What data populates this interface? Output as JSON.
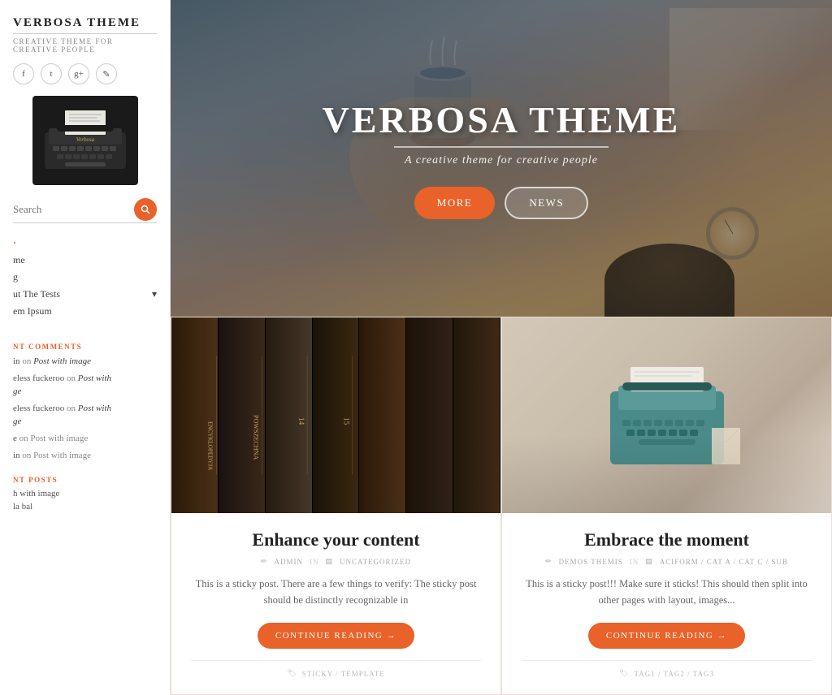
{
  "sidebar": {
    "brand_title": "VERBOSA THEME",
    "brand_subtitle": "CREATIVE THEME FOR CREATIVE PEOPLE",
    "social_icons": [
      "f",
      "t",
      "g+",
      "✎"
    ],
    "search_placeholder": "Search",
    "nav_items": [
      {
        "label": "·",
        "active": true
      },
      {
        "label": "me"
      },
      {
        "label": "g"
      },
      {
        "label": "ut The Tests",
        "has_arrow": true
      },
      {
        "label": "em Ipsum"
      }
    ],
    "recent_comments_title": "NT COMMENTS",
    "comments": [
      {
        "author": "in",
        "on_text": "on",
        "post": "Post with image"
      },
      {
        "author": "eless fuckeroo",
        "on_text": "on Post with",
        "post": "ge"
      },
      {
        "author": "eless fuckeroo",
        "on_text": "on Post with",
        "post": "ge"
      },
      {
        "author": "e",
        "on_text": "on Post with image"
      },
      {
        "author": "in",
        "on_text": "on Post with image"
      }
    ],
    "recent_posts_title": "NT POSTS",
    "recent_posts": [
      {
        "label": "h with image"
      },
      {
        "label": "la bal"
      }
    ]
  },
  "hero": {
    "title": "VERBOSA THEME",
    "subtitle": "A creative theme for creative people",
    "btn_more": "MORE",
    "btn_news": "NEWS"
  },
  "posts": [
    {
      "id": "post1",
      "title": "Enhance your content",
      "author": "ADMIN",
      "category": "UNCATEGORIZED",
      "excerpt": "This is a sticky post. There are a few things to verify: The sticky post should be distinctly recognizable in",
      "continue_label": "CONTINUE READING →",
      "footer_tags": "STICKY / TEMPLATE",
      "thumb_type": "books"
    },
    {
      "id": "post2",
      "title": "Embrace the moment",
      "author": "DEMOS THEMIS",
      "category": "ACIFORM / CAT A / CAT C / SUB",
      "excerpt": "This is a sticky post!!! Make sure it sticks! This should then split into other pages with layout, images...",
      "continue_label": "CONTINUE READING →",
      "footer_tags": "TAG1 / TAG2 / TAG3",
      "thumb_type": "typewriter"
    }
  ],
  "icons": {
    "facebook": "f",
    "twitter": "t",
    "googleplus": "g+",
    "link": "✎",
    "search": "🔍",
    "pen": "✏",
    "folder": "📁",
    "tag": "🏷"
  }
}
